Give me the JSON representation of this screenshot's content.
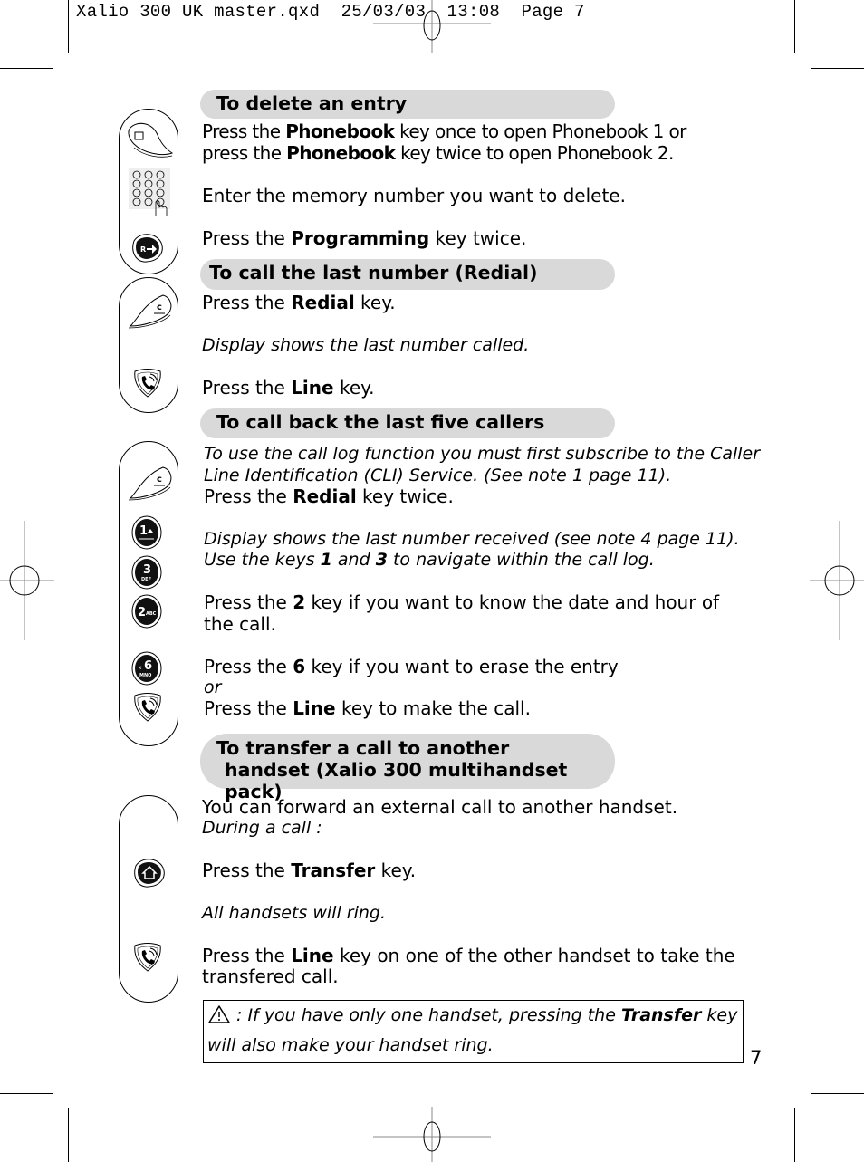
{
  "slug": {
    "file": "Xalio 300 UK master.qxd",
    "date": "25/03/03",
    "time": "13:08",
    "page_label": "Page 7"
  },
  "sections": [
    {
      "title": "To delete an entry",
      "icons": [
        "phonebook-key-icon",
        "keypad-icon",
        "programming-key-icon"
      ],
      "lines": [
        {
          "pre": "Press the ",
          "bold": "Phonebook",
          "post": " key once to open Phonebook 1 or"
        },
        {
          "pre": "press the ",
          "bold": "Phonebook",
          "post": " key twice to open Phonebook 2."
        },
        {
          "text": "Enter the memory number you want to delete."
        },
        {
          "pre": "Press the ",
          "bold": "Programming",
          "post": " key twice."
        }
      ]
    },
    {
      "title": "To call the last number (Redial)",
      "icons": [
        "redial-key-icon",
        "line-key-icon"
      ],
      "lines": [
        {
          "pre": "Press the ",
          "bold": "Redial",
          "post": " key."
        },
        {
          "italic": "Display shows the last number called."
        },
        {
          "pre": "Press the ",
          "bold": "Line",
          "post": " key."
        }
      ]
    },
    {
      "title": "To call back the last five callers",
      "icons": [
        "redial-key-icon",
        "key-1-icon",
        "key-3-icon",
        "key-2-icon",
        "key-6-icon",
        "line-key-icon"
      ],
      "lines": [
        {
          "italic": "To use the call log function you must first subscribe to the Caller"
        },
        {
          "italic": "Line Identification (CLI) Service. (See note 1 page 11)."
        },
        {
          "pre": "Press the ",
          "bold": "Redial",
          "post": " key twice."
        },
        {
          "italic": "Display shows the last number received (see note 4 page 11)."
        },
        {
          "italic_pre": "Use the keys ",
          "bold1": "1",
          "italic_mid": " and ",
          "bold2": "3",
          "italic_post": " to navigate within the call log."
        },
        {
          "pre": "Press the ",
          "bold": "2",
          "post": " key if you want to know the date and hour of"
        },
        {
          "text": "the call."
        },
        {
          "pre": "Press the ",
          "bold": "6",
          "post": " key if you want to erase the entry"
        },
        {
          "italic": "or"
        },
        {
          "pre": "Press the ",
          "bold": "Line",
          "post": " key to make the call."
        }
      ]
    },
    {
      "title_line1": "To transfer a call to another",
      "title_line2": "handset (Xalio 300 multihandset pack)",
      "icons": [
        "transfer-key-icon",
        "line-key-icon"
      ],
      "lines": [
        {
          "text": "You can forward an external call to another handset."
        },
        {
          "italic": "During a call :"
        },
        {
          "pre": "Press the ",
          "bold": "Transfer",
          "post": " key."
        },
        {
          "italic": "All handsets will ring."
        },
        {
          "pre": "Press the ",
          "bold": "Line",
          "post": " key on one of the other handset to take the"
        },
        {
          "text": "transfered call."
        }
      ]
    }
  ],
  "note": {
    "icon": "warning-icon",
    "pre": " : If you have only one handset, pressing the ",
    "bold": "Transfer",
    "post": " key",
    "line2": "will also make your handset ring."
  },
  "page_number": "7",
  "keys": {
    "key1": {
      "digit": "1"
    },
    "key3": {
      "digit": "3",
      "letters": "DEF"
    },
    "key2": {
      "digit": "2",
      "letters": "ABC"
    },
    "key6": {
      "digit": "6",
      "letters": "MNO"
    }
  }
}
